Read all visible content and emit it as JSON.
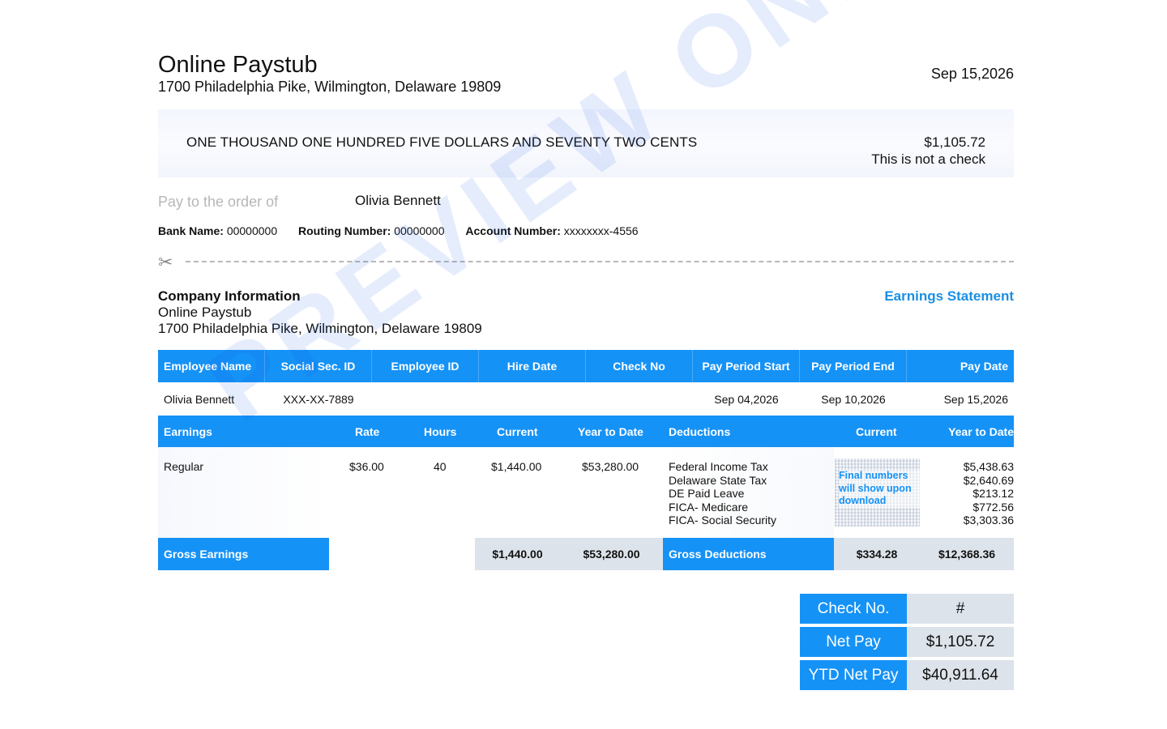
{
  "header": {
    "title": "Online Paystub",
    "address": "1700 Philadelphia Pike, Wilmington, Delaware 19809",
    "date": "Sep 15,2026"
  },
  "check": {
    "amount_words": "ONE THOUSAND ONE HUNDRED FIVE DOLLARS AND SEVENTY TWO CENTS",
    "amount": "$1,105.72",
    "note": "This is not a check",
    "pay_to_label": "Pay to the order of",
    "payee": "Olivia Bennett"
  },
  "bank": {
    "bank_name_label": "Bank Name:",
    "bank_name": "00000000",
    "routing_label": "Routing Number:",
    "routing": "00000000",
    "account_label": "Account Number:",
    "account": "xxxxxxxx-4556"
  },
  "company": {
    "heading": "Company Information",
    "name": "Online Paystub",
    "address": "1700 Philadelphia Pike, Wilmington, Delaware 19809",
    "statement_label": "Earnings Statement"
  },
  "employee_table": {
    "headers": [
      "Employee Name",
      "Social Sec. ID",
      "Employee ID",
      "Hire Date",
      "Check No",
      "Pay Period Start",
      "Pay Period End",
      "Pay Date"
    ],
    "row": [
      "Olivia Bennett",
      "XXX-XX-7889",
      "",
      "",
      "",
      "Sep 04,2026",
      "Sep 10,2026",
      "Sep 15,2026"
    ]
  },
  "earnings": {
    "headers": {
      "earnings": "Earnings",
      "rate": "Rate",
      "hours": "Hours",
      "current": "Current",
      "ytd": "Year to Date",
      "deductions": "Deductions",
      "ded_current": "Current",
      "ded_ytd": "Year to Date"
    },
    "row": {
      "name": "Regular",
      "rate": "$36.00",
      "hours": "40",
      "current": "$1,440.00",
      "ytd": "$53,280.00"
    },
    "deductions": [
      {
        "name": "Federal Income Tax",
        "ytd": "$5,438.63"
      },
      {
        "name": "Delaware State Tax",
        "ytd": "$2,640.69"
      },
      {
        "name": "DE Paid Leave",
        "ytd": "$213.12"
      },
      {
        "name": "FICA- Medicare",
        "ytd": "$772.56"
      },
      {
        "name": "FICA- Social Security",
        "ytd": "$3,303.36"
      }
    ],
    "blurred_note": "Final numbers will show upon download",
    "gross_earnings_label": "Gross Earnings",
    "gross_current": "$1,440.00",
    "gross_ytd": "$53,280.00",
    "gross_deductions_label": "Gross Deductions",
    "gross_ded_current": "$334.28",
    "gross_ded_ytd": "$12,368.36"
  },
  "summary": {
    "check_no_label": "Check No.",
    "check_no": "#",
    "net_pay_label": "Net Pay",
    "net_pay": "$1,105.72",
    "ytd_net_label": "YTD Net Pay",
    "ytd_net": "$40,911.64"
  },
  "watermark": "PREVIEW ONLY",
  "colors": {
    "accent": "#1592f6",
    "statement_link": "#1a8fe3",
    "grey_cell": "#dde3ea"
  }
}
